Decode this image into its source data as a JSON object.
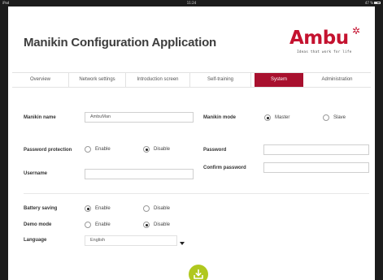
{
  "status_bar": {
    "left": "iPad",
    "time": "11:24",
    "right": "47 %"
  },
  "header": {
    "title": "Manikin Configuration Application",
    "logo_text": "Ambu",
    "logo_tagline": "Ideas that work for life",
    "brand_color": "#c4122f"
  },
  "tabs": [
    {
      "label": "Overview",
      "active": false
    },
    {
      "label": "Network settings",
      "active": false
    },
    {
      "label": "Introduction screen",
      "active": false
    },
    {
      "label": "Self-training",
      "active": false
    },
    {
      "label": "System",
      "active": true
    },
    {
      "label": "Administration",
      "active": false
    }
  ],
  "form": {
    "manikin_name": {
      "label": "Manikin name",
      "value": "AmbuMan"
    },
    "manikin_mode": {
      "label": "Manikin mode",
      "options": [
        {
          "label": "Master",
          "selected": true
        },
        {
          "label": "Slave",
          "selected": false
        }
      ]
    },
    "password_protection": {
      "label": "Password protection",
      "options": [
        {
          "label": "Enable",
          "selected": false
        },
        {
          "label": "Disable",
          "selected": true
        }
      ]
    },
    "password": {
      "label": "Password",
      "value": ""
    },
    "confirm_password": {
      "label": "Confirm password",
      "value": ""
    },
    "username": {
      "label": "Username",
      "value": ""
    },
    "battery_saving": {
      "label": "Battery saving",
      "options": [
        {
          "label": "Enable",
          "selected": true
        },
        {
          "label": "Disable",
          "selected": false
        }
      ]
    },
    "demo_mode": {
      "label": "Demo mode",
      "options": [
        {
          "label": "Enable",
          "selected": false
        },
        {
          "label": "Disable",
          "selected": true
        }
      ]
    },
    "language": {
      "label": "Language",
      "value": "English"
    }
  },
  "actions": {
    "save_icon": "download-tray-icon",
    "save_color": "#b0c81e"
  },
  "colors": {
    "active_tab": "#a8102e"
  }
}
